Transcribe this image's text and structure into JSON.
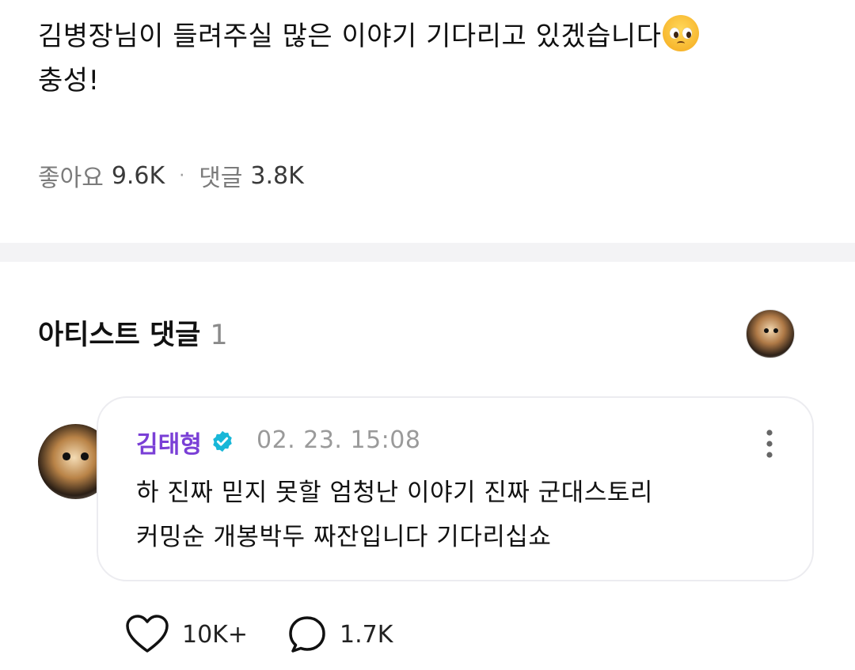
{
  "post": {
    "line1": "김병장님이 들려주실 많은 이야기 기다리고 있겠습니다",
    "emoji": "pleading-face-emoji",
    "line2": "충성!",
    "likes_label": "좋아요",
    "likes_count": "9.6K",
    "comments_label": "댓글",
    "comments_count": "3.8K",
    "separator": "·"
  },
  "artist_comments": {
    "title": "아티스트 댓글",
    "count": "1"
  },
  "comment": {
    "author": "김태형",
    "verified": true,
    "timestamp": "02. 23. 15:08",
    "text_line1": "하 진짜 믿지 못할 엄청난 이야기 진짜 군대스토리",
    "text_line2": "커밍순 개봉박두 짜잔입니다 기다리십쇼",
    "like_count": "10K+",
    "reply_count": "1.7K"
  },
  "colors": {
    "author_name": "#7a3fd6",
    "verified_badge": "#18b7d8",
    "divider": "#f3f3f5",
    "muted_text": "#7b7b7b"
  },
  "icons": {
    "verified": "verified-badge-icon",
    "more": "more-vertical-icon",
    "like": "heart-outline-icon",
    "reply": "comment-bubble-icon"
  }
}
